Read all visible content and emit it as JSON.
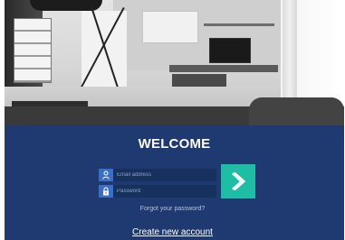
{
  "hero": {
    "image_description": "living-room-interior-photo"
  },
  "login": {
    "title": "WELCOME",
    "email": {
      "placeholder": "Email address",
      "value": "",
      "icon": "user-icon"
    },
    "password": {
      "placeholder": "Password",
      "value": "",
      "icon": "lock-icon"
    },
    "submit_icon": "chevron-right-icon",
    "forgot_password_link": "Forgot your password?",
    "create_account_link": "Create new account"
  },
  "colors": {
    "panel_background": "#1f3a70",
    "field_background": "#17305d",
    "field_icon_background": "#3a6fc4",
    "submit_button": "#1ebea5",
    "text_primary": "#ffffff",
    "text_muted": "#b7c3da"
  }
}
